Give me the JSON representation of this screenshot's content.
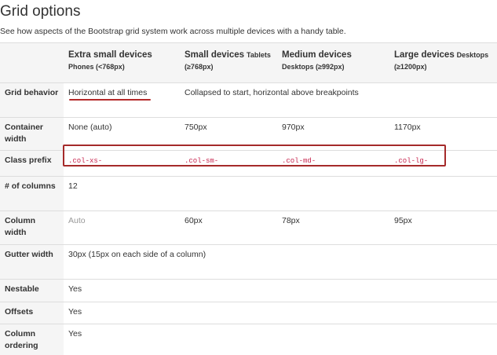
{
  "title": "Grid options",
  "lead": "See how aspects of the Bootstrap grid system work across multiple devices with a handy table.",
  "columns": [
    {
      "main": "Extra small devices",
      "sub": "Phones (<768px)"
    },
    {
      "main": "Small devices",
      "sub_inline": "Tablets",
      "sub": "(≥768px)"
    },
    {
      "main": "Medium devices",
      "sub": "Desktops (≥992px)"
    },
    {
      "main": "Large devices",
      "sub_inline": "Desktops",
      "sub": "(≥1200px)"
    }
  ],
  "rows": {
    "grid_behavior": {
      "label": "Grid behavior",
      "xs": "Horizontal at all times",
      "rest": "Collapsed to start, horizontal above breakpoints"
    },
    "container_width": {
      "label": "Container width",
      "xs": "None (auto)",
      "sm": "750px",
      "md": "970px",
      "lg": "1170px"
    },
    "class_prefix": {
      "label": "Class prefix",
      "xs": ".col-xs-",
      "sm": ".col-sm-",
      "md": ".col-md-",
      "lg": ".col-lg-"
    },
    "num_columns": {
      "label": "# of columns",
      "value": "12"
    },
    "column_width": {
      "label": "Column width",
      "xs": "Auto",
      "sm": "60px",
      "md": "78px",
      "lg": "95px"
    },
    "gutter_width": {
      "label": "Gutter width",
      "value": "30px (15px on each side of a column)"
    },
    "nestable": {
      "label": "Nestable",
      "value": "Yes"
    },
    "offsets": {
      "label": "Offsets",
      "value": "Yes"
    },
    "column_ordering": {
      "label": "Column ordering",
      "value": "Yes"
    }
  },
  "colors": {
    "text": "#333333",
    "shade": "#f5f5f5",
    "code": "#c7254e",
    "annotation": "#a52a2a",
    "muted": "#999999"
  }
}
